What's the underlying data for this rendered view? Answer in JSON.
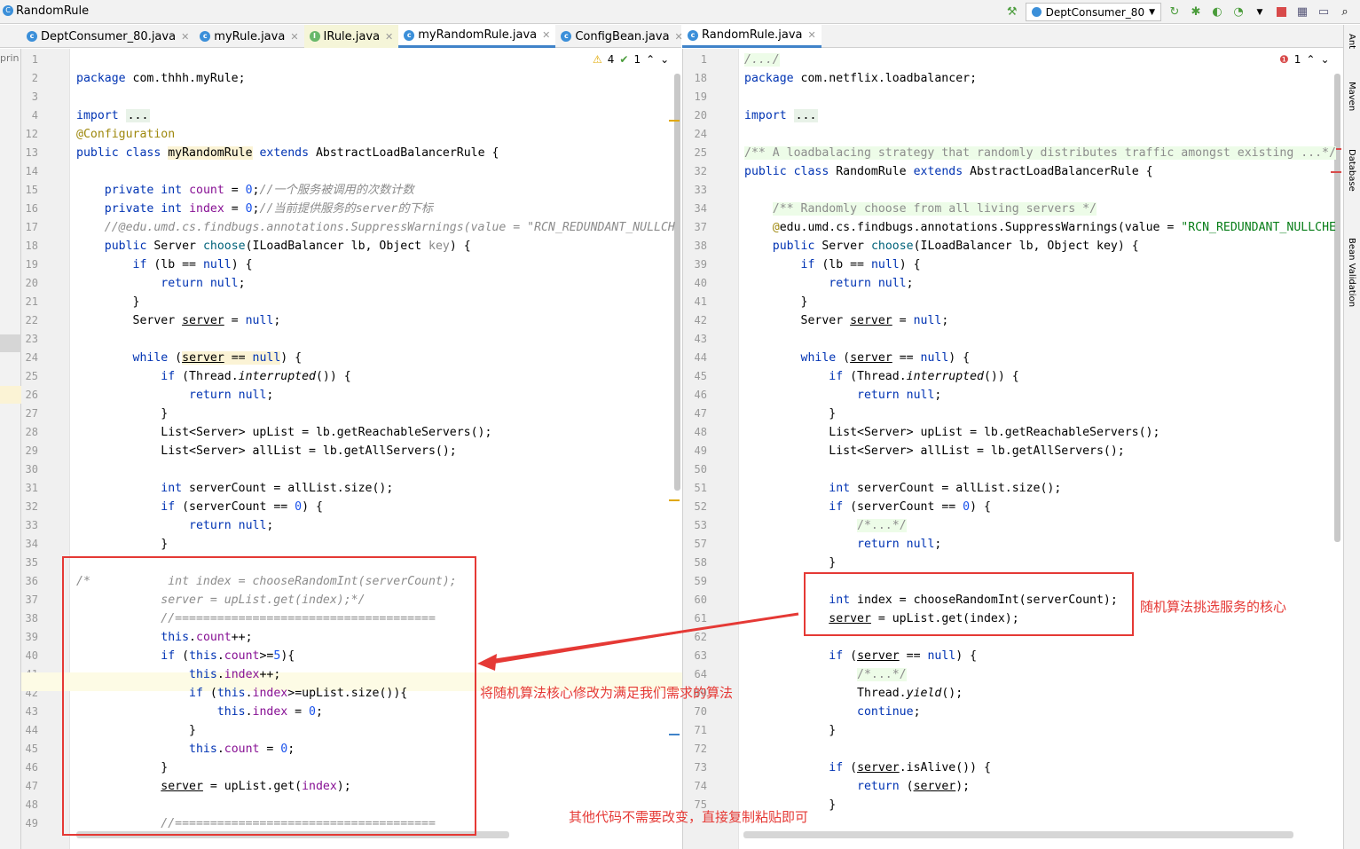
{
  "window": {
    "title": "RandomRule"
  },
  "toolbar": {
    "run_config": "DeptConsumer_80"
  },
  "left_tabs": [
    {
      "label": "DeptConsumer_80.java",
      "kind": "class"
    },
    {
      "label": "myRule.java",
      "kind": "class"
    },
    {
      "label": "IRule.java",
      "kind": "interface"
    },
    {
      "label": "myRandomRule.java",
      "kind": "class",
      "active": true
    },
    {
      "label": "ConfigBean.java",
      "kind": "class"
    }
  ],
  "right_tabs": [
    {
      "label": "RandomRule.java",
      "kind": "class",
      "active": true
    }
  ],
  "left_inspections": {
    "warnings": "4",
    "ok": "1"
  },
  "right_inspections": {
    "errors": "1"
  },
  "left_strip_label": "prin",
  "side_tools": [
    "Ant",
    "Maven",
    "Database",
    "Bean Validation"
  ],
  "left_lines": [
    {
      "n": "1",
      "t": ""
    },
    {
      "n": "2",
      "t": "<span class='kw'>package</span> com.thhh.myRule;"
    },
    {
      "n": "3",
      "t": ""
    },
    {
      "n": "4",
      "t": "<span class='kw'>import</span> <span class='pill'>...</span>"
    },
    {
      "n": "12",
      "t": "<span class='an'>@Configuration</span>"
    },
    {
      "n": "13",
      "t": "<span class='kw'>public class</span> <span class='hlw'>myRandomRule</span> <span class='kw'>extends</span> AbstractLoadBalancerRule {"
    },
    {
      "n": "14",
      "t": ""
    },
    {
      "n": "15",
      "t": "    <span class='kw'>private int</span> <span class='fld'>count</span> = <span class='num'>0</span>;<span class='cm'>//一个服务被调用的次数计数</span>"
    },
    {
      "n": "16",
      "t": "    <span class='kw'>private int</span> <span class='fld'>index</span> = <span class='num'>0</span>;<span class='cm'>//当前提供服务的server的下标</span>"
    },
    {
      "n": "17",
      "t": "    <span class='cm'>//@edu.umd.cs.findbugs.annotations.SuppressWarnings(value = \"RCN_REDUNDANT_NULLCH</span>"
    },
    {
      "n": "18",
      "t": "    <span class='kw'>public</span> Server <span style='color:#00627a'>choose</span>(ILoadBalancer lb, Object <span style='color:#888'>key</span>) {"
    },
    {
      "n": "19",
      "t": "        <span class='kw'>if</span> (lb == <span class='kw'>null</span>) {"
    },
    {
      "n": "20",
      "t": "            <span class='kw'>return null</span>;"
    },
    {
      "n": "21",
      "t": "        }"
    },
    {
      "n": "22",
      "t": "        Server <span class='und'>server</span> = <span class='kw'>null</span>;"
    },
    {
      "n": "23",
      "t": ""
    },
    {
      "n": "24",
      "t": "        <span class='kw'>while</span> (<span class='hlw und'>server</span><span class='hlw'> == </span><span class='hlw kw'>null</span>) {"
    },
    {
      "n": "25",
      "t": "            <span class='kw'>if</span> (Thread.<i>interrupted</i>()) {"
    },
    {
      "n": "26",
      "t": "                <span class='kw'>return null</span>;"
    },
    {
      "n": "27",
      "t": "            }"
    },
    {
      "n": "28",
      "t": "            List&lt;Server&gt; upList = lb.getReachableServers();"
    },
    {
      "n": "29",
      "t": "            List&lt;Server&gt; allList = lb.getAllServers();"
    },
    {
      "n": "30",
      "t": ""
    },
    {
      "n": "31",
      "t": "            <span class='kw'>int</span> serverCount = allList.size();"
    },
    {
      "n": "32",
      "t": "            <span class='kw'>if</span> (serverCount == <span class='num'>0</span>) {"
    },
    {
      "n": "33",
      "t": "                <span class='kw'>return null</span>;"
    },
    {
      "n": "34",
      "t": "            }"
    },
    {
      "n": "35",
      "t": ""
    },
    {
      "n": "36",
      "t": "<span class='cm'>/*           int index = chooseRandomInt(serverCount);</span>"
    },
    {
      "n": "37",
      "t": "<span class='cm'>            server = upList.get(index);*/</span>"
    },
    {
      "n": "38",
      "t": "            <span class='cm'>//=====================================</span>"
    },
    {
      "n": "39",
      "t": "            <span class='kw'>this</span>.<span class='fld'>count</span>++;"
    },
    {
      "n": "40",
      "t": "            <span class='kw'>if</span> (<span class='kw'>this</span>.<span class='fld'>count</span>&gt;=<span class='num'>5</span>){"
    },
    {
      "n": "41",
      "t": "                <span class='kw'>this</span>.<span class='fld'>index</span>++;"
    },
    {
      "n": "42",
      "t": "                <span class='kw'>if</span> (<span class='kw'>this</span>.<span class='fld'>index</span>&gt;=upList.size()){"
    },
    {
      "n": "43",
      "t": "                    <span class='kw'>this</span>.<span class='fld'>index</span> = <span class='num'>0</span>;"
    },
    {
      "n": "44",
      "t": "                }"
    },
    {
      "n": "45",
      "t": "                <span class='kw'>this</span>.<span class='fld'>count</span> = <span class='num'>0</span>;"
    },
    {
      "n": "46",
      "t": "            }"
    },
    {
      "n": "47",
      "t": "            <span class='und'>server</span> = upList.get(<span class='fld'>index</span>);"
    },
    {
      "n": "48",
      "t": ""
    },
    {
      "n": "49",
      "t": "            <span class='cm'>//=====================================</span>"
    }
  ],
  "right_lines": [
    {
      "n": "1",
      "t": "<span class='cm' style='background:#edfce8'>/.../</span>"
    },
    {
      "n": "18",
      "t": "<span class='kw'>package</span> com.netflix.loadbalancer;"
    },
    {
      "n": "19",
      "t": ""
    },
    {
      "n": "20",
      "t": "<span class='kw'>import</span> <span class='pill'>...</span>"
    },
    {
      "n": "24",
      "t": ""
    },
    {
      "n": "25",
      "t": "<span class='cm' style='font-style:normal;background:#edfce8'>/** A loadbalacing strategy that randomly distributes traffic amongst existing ...*/</span>"
    },
    {
      "n": "32",
      "t": "<span class='kw'>public class</span> RandomRule <span class='kw'>extends</span> AbstractLoadBalancerRule {"
    },
    {
      "n": "33",
      "t": ""
    },
    {
      "n": "34",
      "t": "    <span class='cm' style='font-style:normal;background:#edfce8'>/** Randomly choose from all living servers */</span>"
    },
    {
      "n": "37",
      "t": "    <span class='an'>@</span>edu.umd.cs.findbugs.annotations.SuppressWarnings(value = <span class='str'>\"RCN_REDUNDANT_NULLCHE</span>"
    },
    {
      "n": "38",
      "t": "    <span class='kw'>public</span> Server <span style='color:#00627a'>choose</span>(ILoadBalancer lb, Object key) {"
    },
    {
      "n": "39",
      "t": "        <span class='kw'>if</span> (lb == <span class='kw'>null</span>) {"
    },
    {
      "n": "40",
      "t": "            <span class='kw'>return null</span>;"
    },
    {
      "n": "41",
      "t": "        }"
    },
    {
      "n": "42",
      "t": "        Server <span class='und'>server</span> = <span class='kw'>null</span>;"
    },
    {
      "n": "43",
      "t": ""
    },
    {
      "n": "44",
      "t": "        <span class='kw'>while</span> (<span class='und'>server</span> == <span class='kw'>null</span>) {"
    },
    {
      "n": "45",
      "t": "            <span class='kw'>if</span> (Thread.<i>interrupted</i>()) {"
    },
    {
      "n": "46",
      "t": "                <span class='kw'>return null</span>;"
    },
    {
      "n": "47",
      "t": "            }"
    },
    {
      "n": "48",
      "t": "            List&lt;Server&gt; upList = lb.getReachableServers();"
    },
    {
      "n": "49",
      "t": "            List&lt;Server&gt; allList = lb.getAllServers();"
    },
    {
      "n": "50",
      "t": ""
    },
    {
      "n": "51",
      "t": "            <span class='kw'>int</span> serverCount = allList.size();"
    },
    {
      "n": "52",
      "t": "            <span class='kw'>if</span> (serverCount == <span class='num'>0</span>) {"
    },
    {
      "n": "53",
      "t": "                <span class='cm' style='font-style:normal;background:#edfce8'>/*...*/</span>"
    },
    {
      "n": "57",
      "t": "                <span class='kw'>return null</span>;"
    },
    {
      "n": "58",
      "t": "            }"
    },
    {
      "n": "59",
      "t": ""
    },
    {
      "n": "60",
      "t": "            <span class='kw'>int</span> index = chooseRandomInt(serverCount);"
    },
    {
      "n": "61",
      "t": "            <span class='und'>server</span> = upList.get(index);"
    },
    {
      "n": "62",
      "t": ""
    },
    {
      "n": "63",
      "t": "            <span class='kw'>if</span> (<span class='und'>server</span> == <span class='kw'>null</span>) {"
    },
    {
      "n": "64",
      "t": "                <span class='cm' style='font-style:normal;background:#edfce8'>/*...*/</span>"
    },
    {
      "n": "69",
      "t": "                Thread.<i>yield</i>();"
    },
    {
      "n": "70",
      "t": "                <span class='kw'>continue</span>;"
    },
    {
      "n": "71",
      "t": "            }"
    },
    {
      "n": "72",
      "t": ""
    },
    {
      "n": "73",
      "t": "            <span class='kw'>if</span> (<span class='und'>server</span>.isAlive()) {"
    },
    {
      "n": "74",
      "t": "                <span class='kw'>return</span> (<span class='und'>server</span>);"
    },
    {
      "n": "75",
      "t": "            }"
    }
  ],
  "annotations": {
    "left_note": "将随机算法核心修改为满足我们需求的算法",
    "right_note": "随机算法挑选服务的核心",
    "bottom_note": "其他代码不需要改变，直接复制粘贴即可"
  }
}
